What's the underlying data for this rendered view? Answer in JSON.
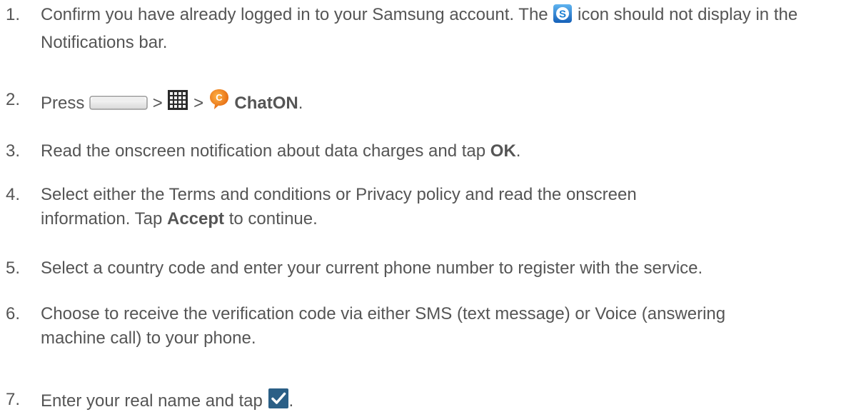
{
  "steps": [
    {
      "number": "1.",
      "text_before": "Confirm you have already logged in to your Samsung account. The",
      "icon": "samsung-account-icon",
      "text_after": "icon should not display in the Notifications bar."
    },
    {
      "number": "2.",
      "text_before": "Press",
      "icon_home": "home-key-icon",
      "sep1": ">",
      "icon_apps": "apps-grid-icon",
      "sep2": ">",
      "icon_chaton": "chaton-icon",
      "bold": "ChatON",
      "text_after": "."
    },
    {
      "number": "3.",
      "text_before": "Read the onscreen notification about data charges and tap",
      "bold": "OK",
      "text_after": "."
    },
    {
      "number": "4.",
      "text_before": "Select either the Terms and conditions or Privacy policy and read the onscreen information. Tap",
      "bold": "Accept",
      "text_after": "to continue."
    },
    {
      "number": "5.",
      "text": "Select a country code and enter your current phone number to register with the service."
    },
    {
      "number": "6.",
      "text": "Choose to receive the verification code via either SMS (text message) or Voice (answering machine call) to your phone."
    },
    {
      "number": "7.",
      "text_before": "Enter your real name and tap",
      "icon": "checkmark-icon",
      "text_after": "."
    }
  ],
  "colors": {
    "text": "#555555",
    "samsung_blue": "#1a7fd4",
    "chaton_orange": "#f07a10",
    "check_blue": "#2b5f86"
  }
}
